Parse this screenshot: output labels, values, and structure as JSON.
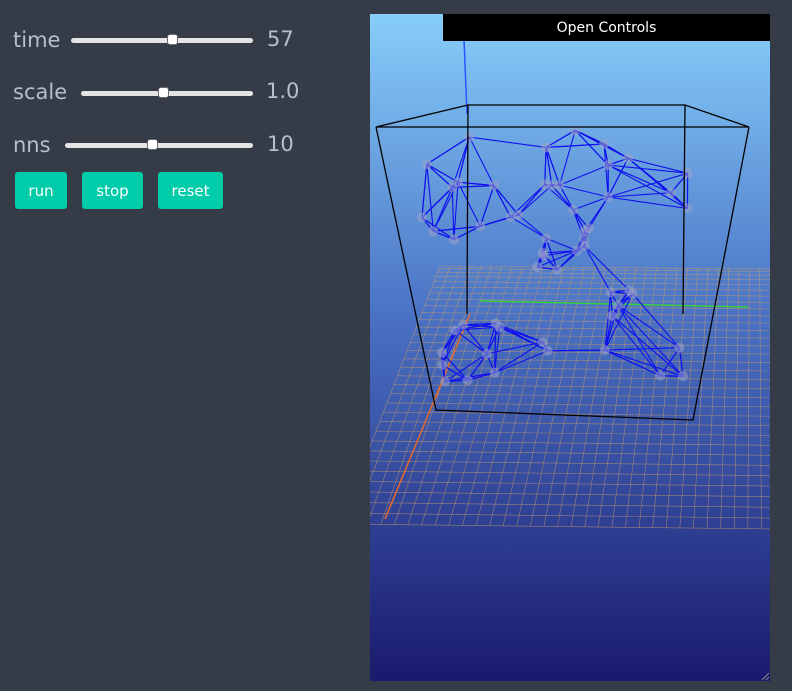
{
  "sliders": [
    {
      "id": "time",
      "label": "time",
      "value": "57",
      "fraction": 0.56
    },
    {
      "id": "scale",
      "label": "scale",
      "value": "1.0",
      "fraction": 0.48
    },
    {
      "id": "nns",
      "label": "nns",
      "value": "10",
      "fraction": 0.47
    }
  ],
  "buttons": {
    "run": "run",
    "stop": "stop",
    "reset": "reset"
  },
  "controls_toggle": "Open Controls",
  "colors": {
    "page_bg": "#353b47",
    "accent": "#00ccaa",
    "label": "#b7bfcc",
    "sky_top": "#87cefa",
    "sky_bottom": "#1a1a6e",
    "edges": "#1010ee",
    "box": "#000000",
    "grid": "#c99a6a"
  }
}
